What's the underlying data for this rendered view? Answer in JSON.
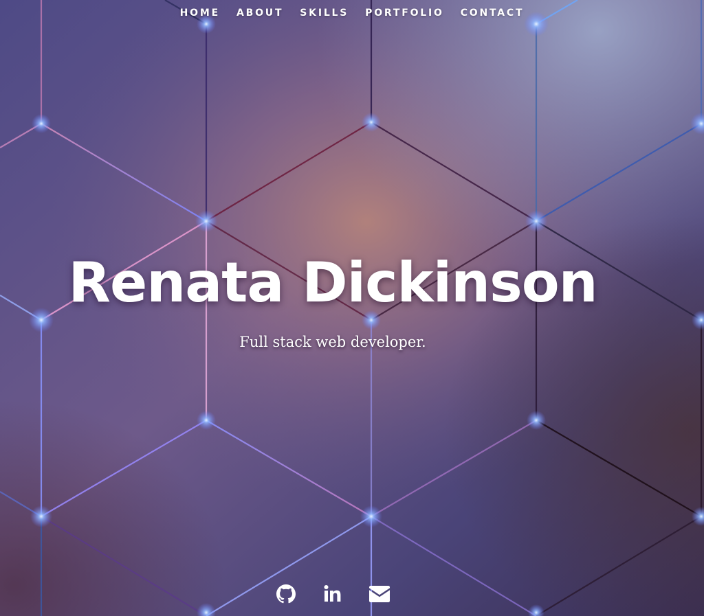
{
  "nav": {
    "items": [
      {
        "label": "HOME"
      },
      {
        "label": "ABOUT"
      },
      {
        "label": "SKILLS"
      },
      {
        "label": "PORTFOLIO"
      },
      {
        "label": "CONTACT"
      }
    ]
  },
  "hero": {
    "name": "Renata Dickinson",
    "tagline": "Full stack web developer."
  },
  "social": {
    "icons": [
      "github-icon",
      "linkedin-icon",
      "envelope-icon"
    ]
  },
  "colors": {
    "text": "#ffffff",
    "background_base": "#5c4c82",
    "glow_center": "#b08278",
    "node_glow": "#7fb8ff"
  }
}
